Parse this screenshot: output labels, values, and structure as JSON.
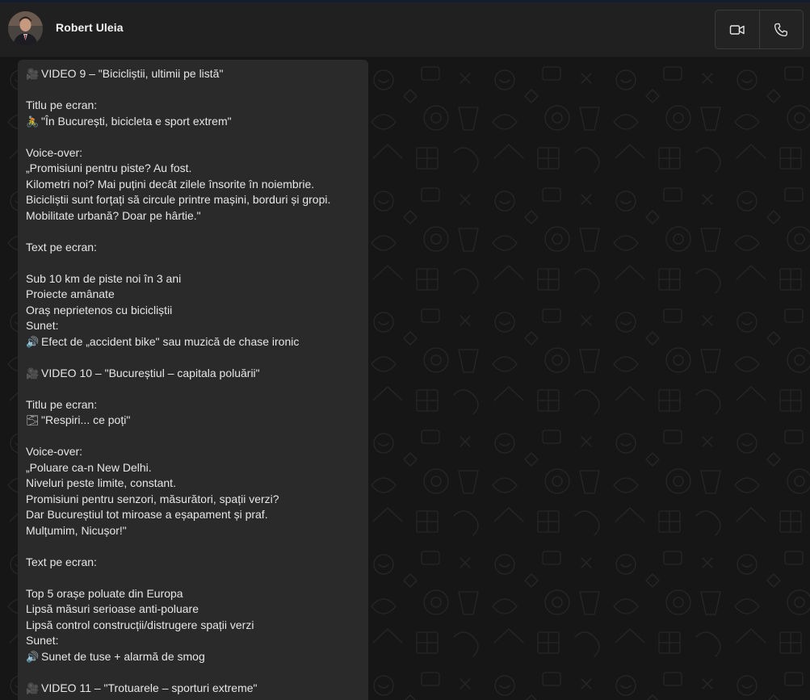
{
  "header": {
    "contact_name": "Robert Uleia",
    "video_call_icon": "video-camera-icon",
    "voice_call_icon": "phone-icon"
  },
  "colors": {
    "header_bg": "#202020",
    "chat_bg": "#161616",
    "bubble_bg": "#2a2a2a",
    "text": "#e6e6e6"
  },
  "message": {
    "lines": [
      {
        "emoji": "🎥",
        "tone": "grey",
        "text": "VIDEO 9 – \"Bicicliștii, ultimii pe listă\""
      },
      {
        "text": ""
      },
      {
        "text": "Titlu pe ecran:"
      },
      {
        "emoji": "🚴",
        "tone": "green",
        "text": "\"În București, bicicleta e sport extrem\""
      },
      {
        "text": ""
      },
      {
        "text": "Voice-over:"
      },
      {
        "text": "„Promisiuni pentru piste? Au fost."
      },
      {
        "text": "Kilometri noi? Mai puțini decât zilele însorite în noiembrie."
      },
      {
        "text": "Bicicliștii sunt forțați să circule printre mașini, borduri și gropi."
      },
      {
        "text": "Mobilitate urbană? Doar pe hârtie.\""
      },
      {
        "text": ""
      },
      {
        "text": "Text pe ecran:"
      },
      {
        "text": ""
      },
      {
        "text": "Sub 10 km de piste noi în 3 ani"
      },
      {
        "text": "Proiecte amânate"
      },
      {
        "text": "Oraș neprietenos cu bicicliștii"
      },
      {
        "text": "Sunet:"
      },
      {
        "emoji": "🔊",
        "tone": "blue",
        "text": "Efect de „accident bike\" sau muzică de chase ironic"
      },
      {
        "text": ""
      },
      {
        "emoji": "🎥",
        "tone": "grey",
        "text": "VIDEO 10 – \"Bucureștiul – capitala poluării\""
      },
      {
        "text": ""
      },
      {
        "text": "Titlu pe ecran:"
      },
      {
        "emoji": "🌫",
        "tone": "white",
        "text": "\"Respiri... ce poți\""
      },
      {
        "text": ""
      },
      {
        "text": "Voice-over:"
      },
      {
        "text": "„Poluare ca-n New Delhi."
      },
      {
        "text": "Niveluri peste limite, constant."
      },
      {
        "text": "Promisiuni pentru senzori, măsurători, spații verzi?"
      },
      {
        "text": "Dar Bucureștiul tot miroase a eșapament și praf."
      },
      {
        "text": "Mulțumim, Nicușor!\""
      },
      {
        "text": ""
      },
      {
        "text": "Text pe ecran:"
      },
      {
        "text": ""
      },
      {
        "text": "Top 5 orașe poluate din Europa"
      },
      {
        "text": "Lipsă măsuri serioase anti-poluare"
      },
      {
        "text": "Lipsă control construcții/distrugere spații verzi"
      },
      {
        "text": "Sunet:"
      },
      {
        "emoji": "🔊",
        "tone": "blue",
        "text": "Sunet de tuse + alarmă de smog"
      },
      {
        "text": ""
      },
      {
        "emoji": "🎥",
        "tone": "grey",
        "text": "VIDEO 11 – \"Trotuarele – sporturi extreme\""
      }
    ]
  }
}
